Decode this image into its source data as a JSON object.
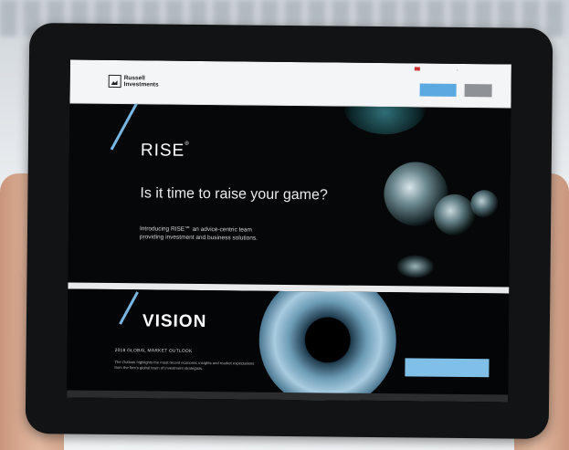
{
  "utility": {
    "region_label": "",
    "links": []
  },
  "header": {
    "logo_line1": "Russell",
    "logo_line2": "Investments",
    "nav_items": [
      "",
      "",
      "",
      ""
    ],
    "login_label": "",
    "signup_label": ""
  },
  "hero": {
    "title": "RISE",
    "title_mark": "®",
    "headline": "Is it time to raise your game?",
    "subtext_line1": "Introducing RISE℠ an advice-centric team",
    "subtext_line2": "providing investment and business solutions."
  },
  "vision": {
    "title": "VISION",
    "subtitle": "2018 GLOBAL MARKET OUTLOOK",
    "body": "The Outlook highlights the most recent economic insights and market expectations from the firm's global team of investment strategists.",
    "cta_label": ""
  },
  "colors": {
    "accent_blue": "#78b6e3",
    "login_button": "#5ba9e0",
    "signup_button": "#8e9296",
    "cta_button": "#7fbfe8"
  }
}
